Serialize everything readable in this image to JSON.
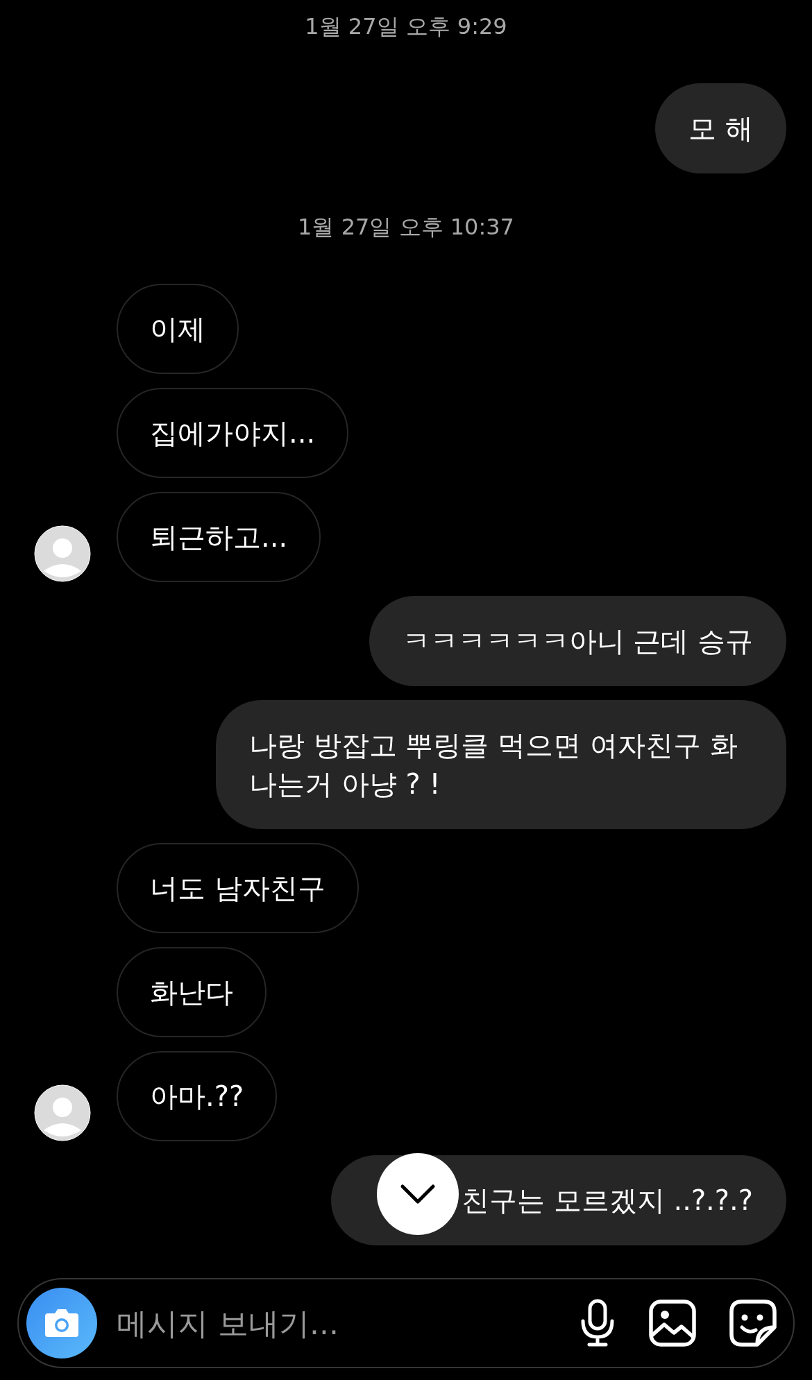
{
  "messages": [
    {
      "kind": "timestamp",
      "text": "1월 27일 오후 9:29"
    },
    {
      "kind": "sent",
      "text": "모 해"
    },
    {
      "kind": "timestamp",
      "text": "1월 27일 오후 10:37"
    },
    {
      "kind": "received",
      "text": "이제",
      "avatar": false
    },
    {
      "kind": "received",
      "text": "집에가야지...",
      "avatar": false
    },
    {
      "kind": "received",
      "text": "퇴근하고...",
      "avatar": true
    },
    {
      "kind": "sent",
      "text": "ㅋㅋㅋㅋㅋㅋ아니 근데 승규"
    },
    {
      "kind": "sent",
      "text": "나랑 방잡고 뿌링클 먹으면 여자친구 화나는거 아냥 ? !"
    },
    {
      "kind": "received",
      "text": "너도 남자친구",
      "avatar": false
    },
    {
      "kind": "received",
      "text": "화난다",
      "avatar": false
    },
    {
      "kind": "received",
      "text": "아마.??",
      "avatar": true
    },
    {
      "kind": "sent",
      "text": "친구는 모르겠지 ..?.?.?",
      "scroll_button_over": true
    }
  ],
  "composer": {
    "placeholder": "메시지 보내기..."
  }
}
